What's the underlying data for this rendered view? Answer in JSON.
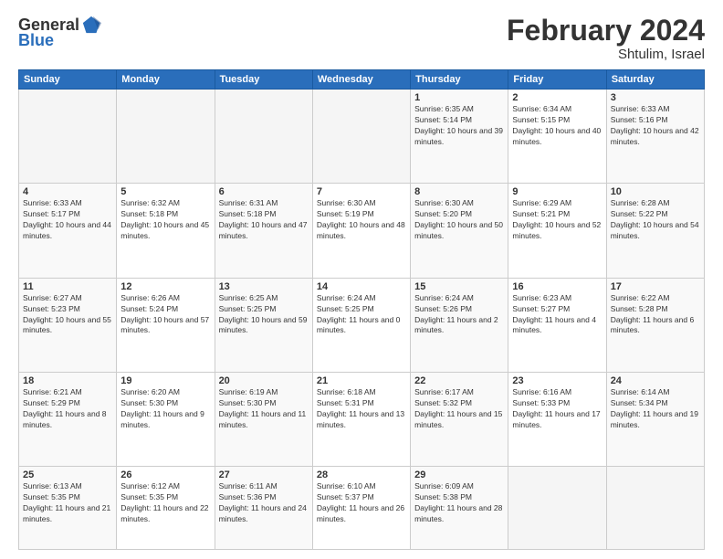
{
  "logo": {
    "general": "General",
    "blue": "Blue"
  },
  "header": {
    "month": "February 2024",
    "location": "Shtulim, Israel"
  },
  "weekdays": [
    "Sunday",
    "Monday",
    "Tuesday",
    "Wednesday",
    "Thursday",
    "Friday",
    "Saturday"
  ],
  "weeks": [
    [
      {
        "day": "",
        "sunrise": "",
        "sunset": "",
        "daylight": "",
        "empty": true
      },
      {
        "day": "",
        "sunrise": "",
        "sunset": "",
        "daylight": "",
        "empty": true
      },
      {
        "day": "",
        "sunrise": "",
        "sunset": "",
        "daylight": "",
        "empty": true
      },
      {
        "day": "",
        "sunrise": "",
        "sunset": "",
        "daylight": "",
        "empty": true
      },
      {
        "day": "1",
        "sunrise": "Sunrise: 6:35 AM",
        "sunset": "Sunset: 5:14 PM",
        "daylight": "Daylight: 10 hours and 39 minutes.",
        "empty": false
      },
      {
        "day": "2",
        "sunrise": "Sunrise: 6:34 AM",
        "sunset": "Sunset: 5:15 PM",
        "daylight": "Daylight: 10 hours and 40 minutes.",
        "empty": false
      },
      {
        "day": "3",
        "sunrise": "Sunrise: 6:33 AM",
        "sunset": "Sunset: 5:16 PM",
        "daylight": "Daylight: 10 hours and 42 minutes.",
        "empty": false
      }
    ],
    [
      {
        "day": "4",
        "sunrise": "Sunrise: 6:33 AM",
        "sunset": "Sunset: 5:17 PM",
        "daylight": "Daylight: 10 hours and 44 minutes.",
        "empty": false
      },
      {
        "day": "5",
        "sunrise": "Sunrise: 6:32 AM",
        "sunset": "Sunset: 5:18 PM",
        "daylight": "Daylight: 10 hours and 45 minutes.",
        "empty": false
      },
      {
        "day": "6",
        "sunrise": "Sunrise: 6:31 AM",
        "sunset": "Sunset: 5:18 PM",
        "daylight": "Daylight: 10 hours and 47 minutes.",
        "empty": false
      },
      {
        "day": "7",
        "sunrise": "Sunrise: 6:30 AM",
        "sunset": "Sunset: 5:19 PM",
        "daylight": "Daylight: 10 hours and 48 minutes.",
        "empty": false
      },
      {
        "day": "8",
        "sunrise": "Sunrise: 6:30 AM",
        "sunset": "Sunset: 5:20 PM",
        "daylight": "Daylight: 10 hours and 50 minutes.",
        "empty": false
      },
      {
        "day": "9",
        "sunrise": "Sunrise: 6:29 AM",
        "sunset": "Sunset: 5:21 PM",
        "daylight": "Daylight: 10 hours and 52 minutes.",
        "empty": false
      },
      {
        "day": "10",
        "sunrise": "Sunrise: 6:28 AM",
        "sunset": "Sunset: 5:22 PM",
        "daylight": "Daylight: 10 hours and 54 minutes.",
        "empty": false
      }
    ],
    [
      {
        "day": "11",
        "sunrise": "Sunrise: 6:27 AM",
        "sunset": "Sunset: 5:23 PM",
        "daylight": "Daylight: 10 hours and 55 minutes.",
        "empty": false
      },
      {
        "day": "12",
        "sunrise": "Sunrise: 6:26 AM",
        "sunset": "Sunset: 5:24 PM",
        "daylight": "Daylight: 10 hours and 57 minutes.",
        "empty": false
      },
      {
        "day": "13",
        "sunrise": "Sunrise: 6:25 AM",
        "sunset": "Sunset: 5:25 PM",
        "daylight": "Daylight: 10 hours and 59 minutes.",
        "empty": false
      },
      {
        "day": "14",
        "sunrise": "Sunrise: 6:24 AM",
        "sunset": "Sunset: 5:25 PM",
        "daylight": "Daylight: 11 hours and 0 minutes.",
        "empty": false
      },
      {
        "day": "15",
        "sunrise": "Sunrise: 6:24 AM",
        "sunset": "Sunset: 5:26 PM",
        "daylight": "Daylight: 11 hours and 2 minutes.",
        "empty": false
      },
      {
        "day": "16",
        "sunrise": "Sunrise: 6:23 AM",
        "sunset": "Sunset: 5:27 PM",
        "daylight": "Daylight: 11 hours and 4 minutes.",
        "empty": false
      },
      {
        "day": "17",
        "sunrise": "Sunrise: 6:22 AM",
        "sunset": "Sunset: 5:28 PM",
        "daylight": "Daylight: 11 hours and 6 minutes.",
        "empty": false
      }
    ],
    [
      {
        "day": "18",
        "sunrise": "Sunrise: 6:21 AM",
        "sunset": "Sunset: 5:29 PM",
        "daylight": "Daylight: 11 hours and 8 minutes.",
        "empty": false
      },
      {
        "day": "19",
        "sunrise": "Sunrise: 6:20 AM",
        "sunset": "Sunset: 5:30 PM",
        "daylight": "Daylight: 11 hours and 9 minutes.",
        "empty": false
      },
      {
        "day": "20",
        "sunrise": "Sunrise: 6:19 AM",
        "sunset": "Sunset: 5:30 PM",
        "daylight": "Daylight: 11 hours and 11 minutes.",
        "empty": false
      },
      {
        "day": "21",
        "sunrise": "Sunrise: 6:18 AM",
        "sunset": "Sunset: 5:31 PM",
        "daylight": "Daylight: 11 hours and 13 minutes.",
        "empty": false
      },
      {
        "day": "22",
        "sunrise": "Sunrise: 6:17 AM",
        "sunset": "Sunset: 5:32 PM",
        "daylight": "Daylight: 11 hours and 15 minutes.",
        "empty": false
      },
      {
        "day": "23",
        "sunrise": "Sunrise: 6:16 AM",
        "sunset": "Sunset: 5:33 PM",
        "daylight": "Daylight: 11 hours and 17 minutes.",
        "empty": false
      },
      {
        "day": "24",
        "sunrise": "Sunrise: 6:14 AM",
        "sunset": "Sunset: 5:34 PM",
        "daylight": "Daylight: 11 hours and 19 minutes.",
        "empty": false
      }
    ],
    [
      {
        "day": "25",
        "sunrise": "Sunrise: 6:13 AM",
        "sunset": "Sunset: 5:35 PM",
        "daylight": "Daylight: 11 hours and 21 minutes.",
        "empty": false
      },
      {
        "day": "26",
        "sunrise": "Sunrise: 6:12 AM",
        "sunset": "Sunset: 5:35 PM",
        "daylight": "Daylight: 11 hours and 22 minutes.",
        "empty": false
      },
      {
        "day": "27",
        "sunrise": "Sunrise: 6:11 AM",
        "sunset": "Sunset: 5:36 PM",
        "daylight": "Daylight: 11 hours and 24 minutes.",
        "empty": false
      },
      {
        "day": "28",
        "sunrise": "Sunrise: 6:10 AM",
        "sunset": "Sunset: 5:37 PM",
        "daylight": "Daylight: 11 hours and 26 minutes.",
        "empty": false
      },
      {
        "day": "29",
        "sunrise": "Sunrise: 6:09 AM",
        "sunset": "Sunset: 5:38 PM",
        "daylight": "Daylight: 11 hours and 28 minutes.",
        "empty": false
      },
      {
        "day": "",
        "sunrise": "",
        "sunset": "",
        "daylight": "",
        "empty": true
      },
      {
        "day": "",
        "sunrise": "",
        "sunset": "",
        "daylight": "",
        "empty": true
      }
    ]
  ]
}
